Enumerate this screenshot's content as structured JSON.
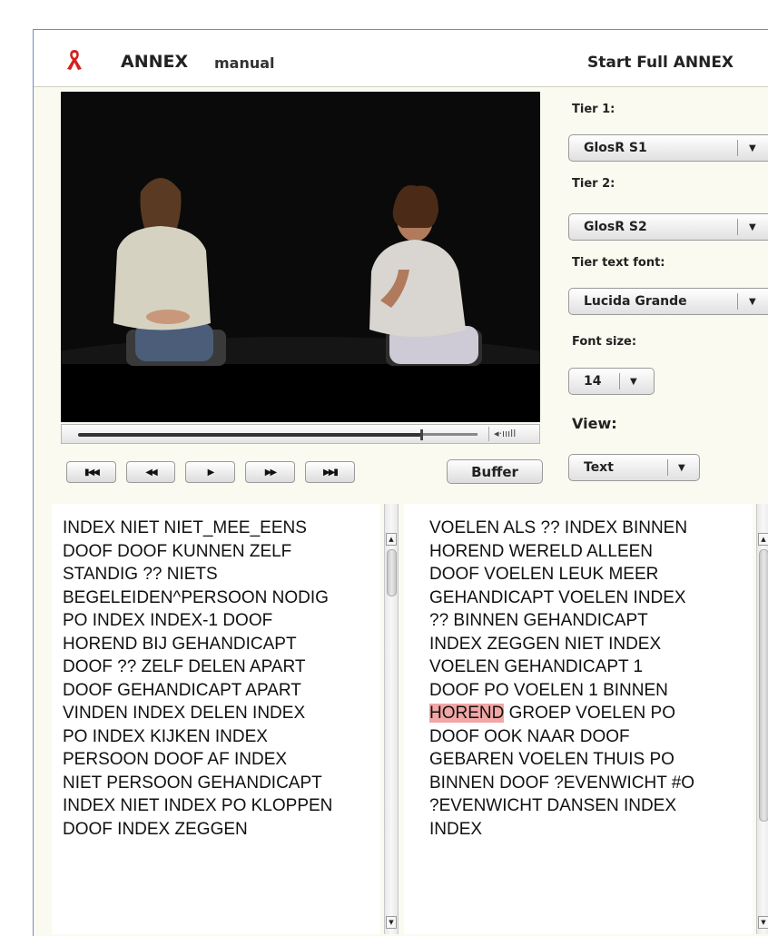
{
  "header": {
    "app_name": "ANNEX",
    "mode": "manual",
    "start_full_label": "Start Full ANNEX",
    "logo_color": "#d42020"
  },
  "video": {
    "volume_icon": "speaker-volume-icon"
  },
  "transport": [
    {
      "name": "skip-to-start",
      "glyph": "▶◀◀",
      "label": "⏮"
    },
    {
      "name": "rewind",
      "label": "◀◀"
    },
    {
      "name": "play",
      "label": "▶"
    },
    {
      "name": "fast-forward",
      "label": "▶▶"
    },
    {
      "name": "skip-to-end",
      "label": "▶▶▌"
    }
  ],
  "buffer_label": "Buffer",
  "sidebar": {
    "tier1_label": "Tier 1:",
    "tier1_value": "GlosR S1",
    "tier2_label": "Tier 2:",
    "tier2_value": "GlosR S2",
    "font_label": "Tier text font:",
    "font_value": "Lucida Grande",
    "size_label": "Font size:",
    "size_value": "14",
    "view_label": "View:",
    "view_value": "Text"
  },
  "tier1_text": {
    "lines": [
      "INDEX NIET NIET_MEE_EENS",
      "DOOF DOOF KUNNEN ZELF",
      "STANDIG ?? NIETS",
      "BEGELEIDEN^PERSOON NODIG",
      "PO INDEX INDEX-1 DOOF",
      "HOREND BIJ GEHANDICAPT",
      "DOOF ?? ZELF DELEN APART",
      "DOOF GEHANDICAPT APART",
      "VINDEN INDEX DELEN INDEX",
      "PO INDEX KIJKEN INDEX",
      "PERSOON DOOF AF INDEX",
      "NIET PERSOON GEHANDICAPT",
      "INDEX NIET INDEX PO KLOPPEN",
      "DOOF INDEX ZEGGEN"
    ]
  },
  "tier2_text": {
    "lines": [
      "VOELEN ALS ?? INDEX BINNEN",
      "HOREND WERELD ALLEEN",
      "DOOF VOELEN LEUK MEER",
      "GEHANDICAPT VOELEN INDEX",
      "?? BINNEN GEHANDICAPT",
      "INDEX ZEGGEN NIET INDEX",
      "VOELEN GEHANDICAPT 1",
      "DOOF PO VOELEN 1 BINNEN",
      "GROEP VOELEN PO",
      "DOOF OOK NAAR DOOF",
      "GEBAREN VOELEN THUIS PO",
      "BINNEN DOOF ?EVENWICHT #O",
      "?EVENWICHT DANSEN INDEX",
      "INDEX"
    ],
    "highlight_word": "HOREND",
    "highlight_color": "#f2a6a6"
  }
}
